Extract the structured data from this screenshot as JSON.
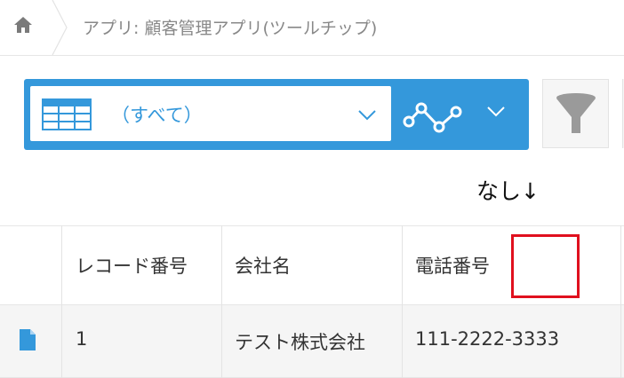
{
  "breadcrumb": {
    "home_icon": "home-icon",
    "app_title": "アプリ: 顧客管理アプリ(ツールチップ)"
  },
  "view_selector": {
    "accent_color": "#3498db",
    "icon": "table-icon",
    "selected_view": "（すべて）",
    "dropdown_icon": "chevron-down-icon",
    "graph_icon": "line-graph-icon"
  },
  "filter": {
    "icon": "funnel-icon"
  },
  "annotation": {
    "text": "なし↓",
    "highlight_color": "#e0101e"
  },
  "table": {
    "headers": [
      "",
      "レコード番号",
      "会社名",
      "電話番号"
    ],
    "rows": [
      {
        "detail_icon": "document-icon",
        "record_number": "1",
        "company": "テスト株式会社",
        "phone": "111-2222-3333"
      }
    ]
  }
}
